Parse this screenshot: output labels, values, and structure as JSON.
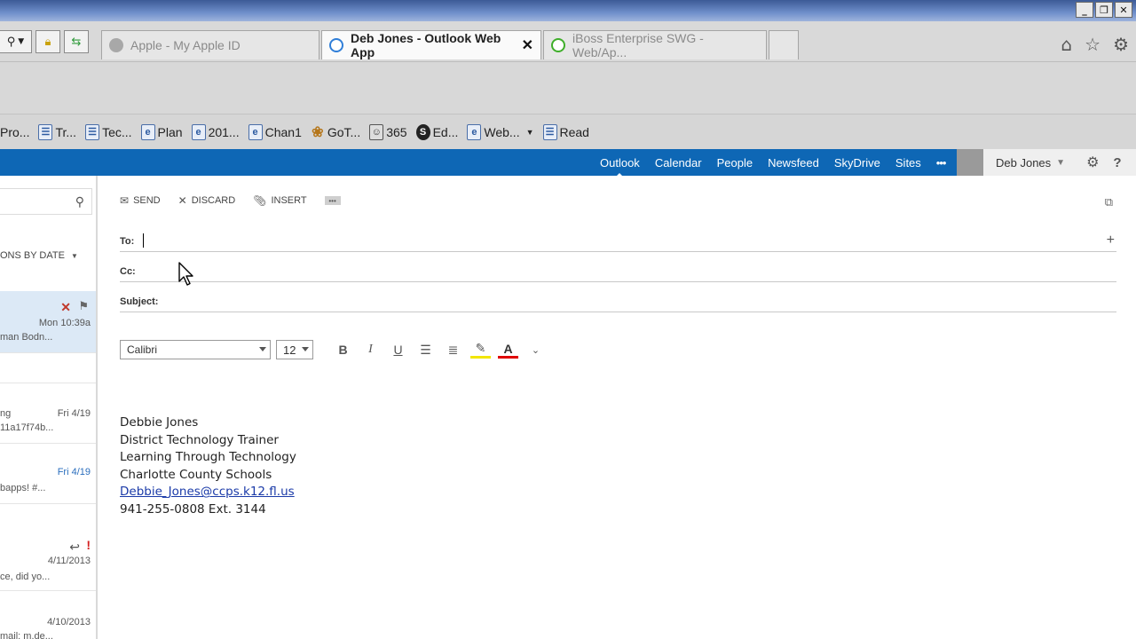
{
  "browser": {
    "tabs": [
      {
        "label": "Apple - My Apple ID",
        "active": false,
        "icon": "apple-icon"
      },
      {
        "label": "Deb Jones - Outlook Web App",
        "active": true,
        "icon": "ie-icon"
      },
      {
        "label": "iBoss Enterprise SWG - Web/Ap...",
        "active": false,
        "icon": "power-icon"
      }
    ],
    "favorites": [
      {
        "label": "Pro...",
        "icon": "page-icon"
      },
      {
        "label": "Tr...",
        "icon": "page-icon"
      },
      {
        "label": "Tec...",
        "icon": "page-icon"
      },
      {
        "label": "Plan",
        "icon": "ie-icon"
      },
      {
        "label": "201...",
        "icon": "ie-icon"
      },
      {
        "label": "Chan1",
        "icon": "ie-icon"
      },
      {
        "label": "GoT...",
        "icon": "flower-icon"
      },
      {
        "label": "365",
        "icon": "people-icon"
      },
      {
        "label": "Ed...",
        "icon": "swirl-icon"
      },
      {
        "label": "Web...",
        "icon": "ie-icon"
      },
      {
        "label": "Read",
        "icon": "page-icon"
      }
    ]
  },
  "owa": {
    "nav": [
      "Outlook",
      "Calendar",
      "People",
      "Newsfeed",
      "SkyDrive",
      "Sites"
    ],
    "active_nav": "Outlook",
    "more": "•••",
    "user": "Deb Jones"
  },
  "list": {
    "sort_label": "ONS BY DATE",
    "messages": [
      {
        "date": "Mon 10:39a",
        "preview": "man Bodn...",
        "selected": true,
        "date_color": "#2a6ebd"
      },
      {
        "date": "Fri 4/19",
        "preview": "11a17f74b...",
        "selected": false,
        "pre": "ng",
        "date_color": "#555555"
      },
      {
        "date": "Fri 4/19",
        "preview": "bapps! #...",
        "selected": false,
        "date_color": "#2a6ebd"
      },
      {
        "date": "4/11/2013",
        "preview": "ce, did yo...",
        "selected": false,
        "date_color": "#555555"
      },
      {
        "date": "4/10/2013",
        "preview": "mail: m.de...",
        "selected": false,
        "date_color": "#555555"
      }
    ]
  },
  "compose": {
    "toolbar": {
      "send": "SEND",
      "discard": "DISCARD",
      "insert": "INSERT"
    },
    "to_label": "To:",
    "cc_label": "Cc:",
    "subject_label": "Subject:",
    "font": "Calibri",
    "size": "12",
    "signature": {
      "name": "Debbie Jones",
      "title": "District Technology Trainer",
      "dept": "Learning Through Technology",
      "org": "Charlotte County Schools",
      "email": "Debbie_Jones@ccps.k12.fl.us",
      "phone": "941-255-0808 Ext. 3144"
    }
  },
  "colors": {
    "nav_blue": "#0e67b5",
    "selected_row": "#dce9f6",
    "highlight_yellow": "#f2e600",
    "font_color_red": "#e00000"
  }
}
